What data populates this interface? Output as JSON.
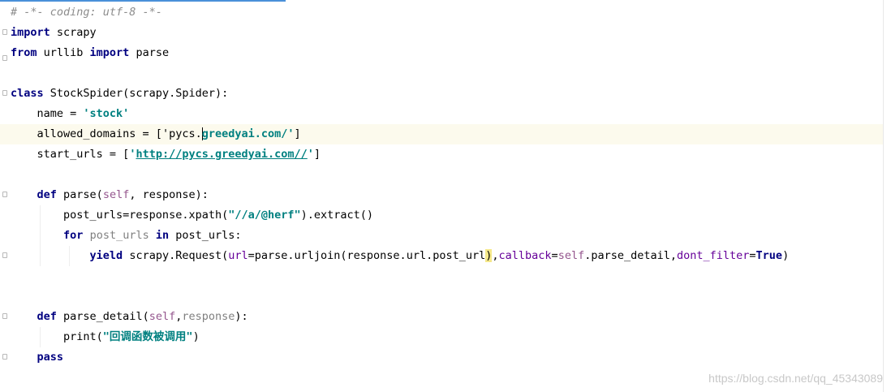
{
  "editor": {
    "lines": [
      {
        "tokens": [
          {
            "t": "# -*- coding: utf-8 -*-",
            "c": "cm"
          }
        ]
      },
      {
        "tokens": [
          {
            "t": "import",
            "c": "kw"
          },
          {
            "t": " scrapy"
          }
        ]
      },
      {
        "tokens": [
          {
            "t": "from",
            "c": "kw"
          },
          {
            "t": " urllib "
          },
          {
            "t": "import",
            "c": "kw"
          },
          {
            "t": " parse"
          }
        ]
      },
      {
        "tokens": []
      },
      {
        "tokens": [
          {
            "t": "class",
            "c": "kw"
          },
          {
            "t": " StockSpider(scrapy.Spider):"
          }
        ]
      },
      {
        "tokens": [
          {
            "t": "    name = "
          },
          {
            "t": "'stock'",
            "c": "str"
          }
        ]
      },
      {
        "tokens": [
          {
            "t": "    allowed_domains = ["
          },
          {
            "t": "'pycs."
          },
          {
            "t": "greedyai.com/'",
            "c": "str"
          },
          {
            "t": "]"
          }
        ],
        "current": true
      },
      {
        "tokens": [
          {
            "t": "    start_urls = ["
          },
          {
            "t": "'",
            "c": "str"
          },
          {
            "t": "http://pycs.greedyai.com//",
            "c": "url"
          },
          {
            "t": "'",
            "c": "str"
          },
          {
            "t": "]"
          }
        ]
      },
      {
        "tokens": []
      },
      {
        "tokens": [
          {
            "t": "    "
          },
          {
            "t": "def",
            "c": "kw"
          },
          {
            "t": " parse("
          },
          {
            "t": "self",
            "c": "self"
          },
          {
            "t": ", response):"
          }
        ]
      },
      {
        "tokens": [
          {
            "t": "        post_urls=response.xpath("
          },
          {
            "t": "\"//a/@herf\"",
            "c": "str"
          },
          {
            "t": ").extract()"
          }
        ]
      },
      {
        "tokens": [
          {
            "t": "        "
          },
          {
            "t": "for",
            "c": "kw"
          },
          {
            "t": " "
          },
          {
            "t": "post_urls",
            "c": "unused"
          },
          {
            "t": " "
          },
          {
            "t": "in",
            "c": "kw"
          },
          {
            "t": " post_urls:"
          }
        ]
      },
      {
        "tokens": [
          {
            "t": "            "
          },
          {
            "t": "yield",
            "c": "kw"
          },
          {
            "t": " scrapy.Request("
          },
          {
            "t": "url",
            "c": "kwarg"
          },
          {
            "t": "=parse.urljoin(response.url.post_url"
          },
          {
            "t": ")",
            "c": "bracket"
          },
          {
            "t": ","
          },
          {
            "t": "callback",
            "c": "kwarg"
          },
          {
            "t": "="
          },
          {
            "t": "self",
            "c": "self"
          },
          {
            "t": ".parse_detail,"
          },
          {
            "t": "dont_filter",
            "c": "kwarg"
          },
          {
            "t": "="
          },
          {
            "t": "True",
            "c": "kw"
          },
          {
            "t": ")"
          }
        ]
      },
      {
        "tokens": []
      },
      {
        "tokens": []
      },
      {
        "tokens": [
          {
            "t": "    "
          },
          {
            "t": "def",
            "c": "kw"
          },
          {
            "t": " parse_detail("
          },
          {
            "t": "self",
            "c": "self"
          },
          {
            "t": ","
          },
          {
            "t": "response",
            "c": "unused"
          },
          {
            "t": "):"
          }
        ]
      },
      {
        "tokens": [
          {
            "t": "        print("
          },
          {
            "t": "\"回调函数被调用\"",
            "c": "str"
          },
          {
            "t": ")"
          }
        ]
      },
      {
        "tokens": [
          {
            "t": "    "
          },
          {
            "t": "pass",
            "c": "kw"
          }
        ]
      }
    ]
  },
  "watermark": "https://blog.csdn.net/qq_45343089"
}
